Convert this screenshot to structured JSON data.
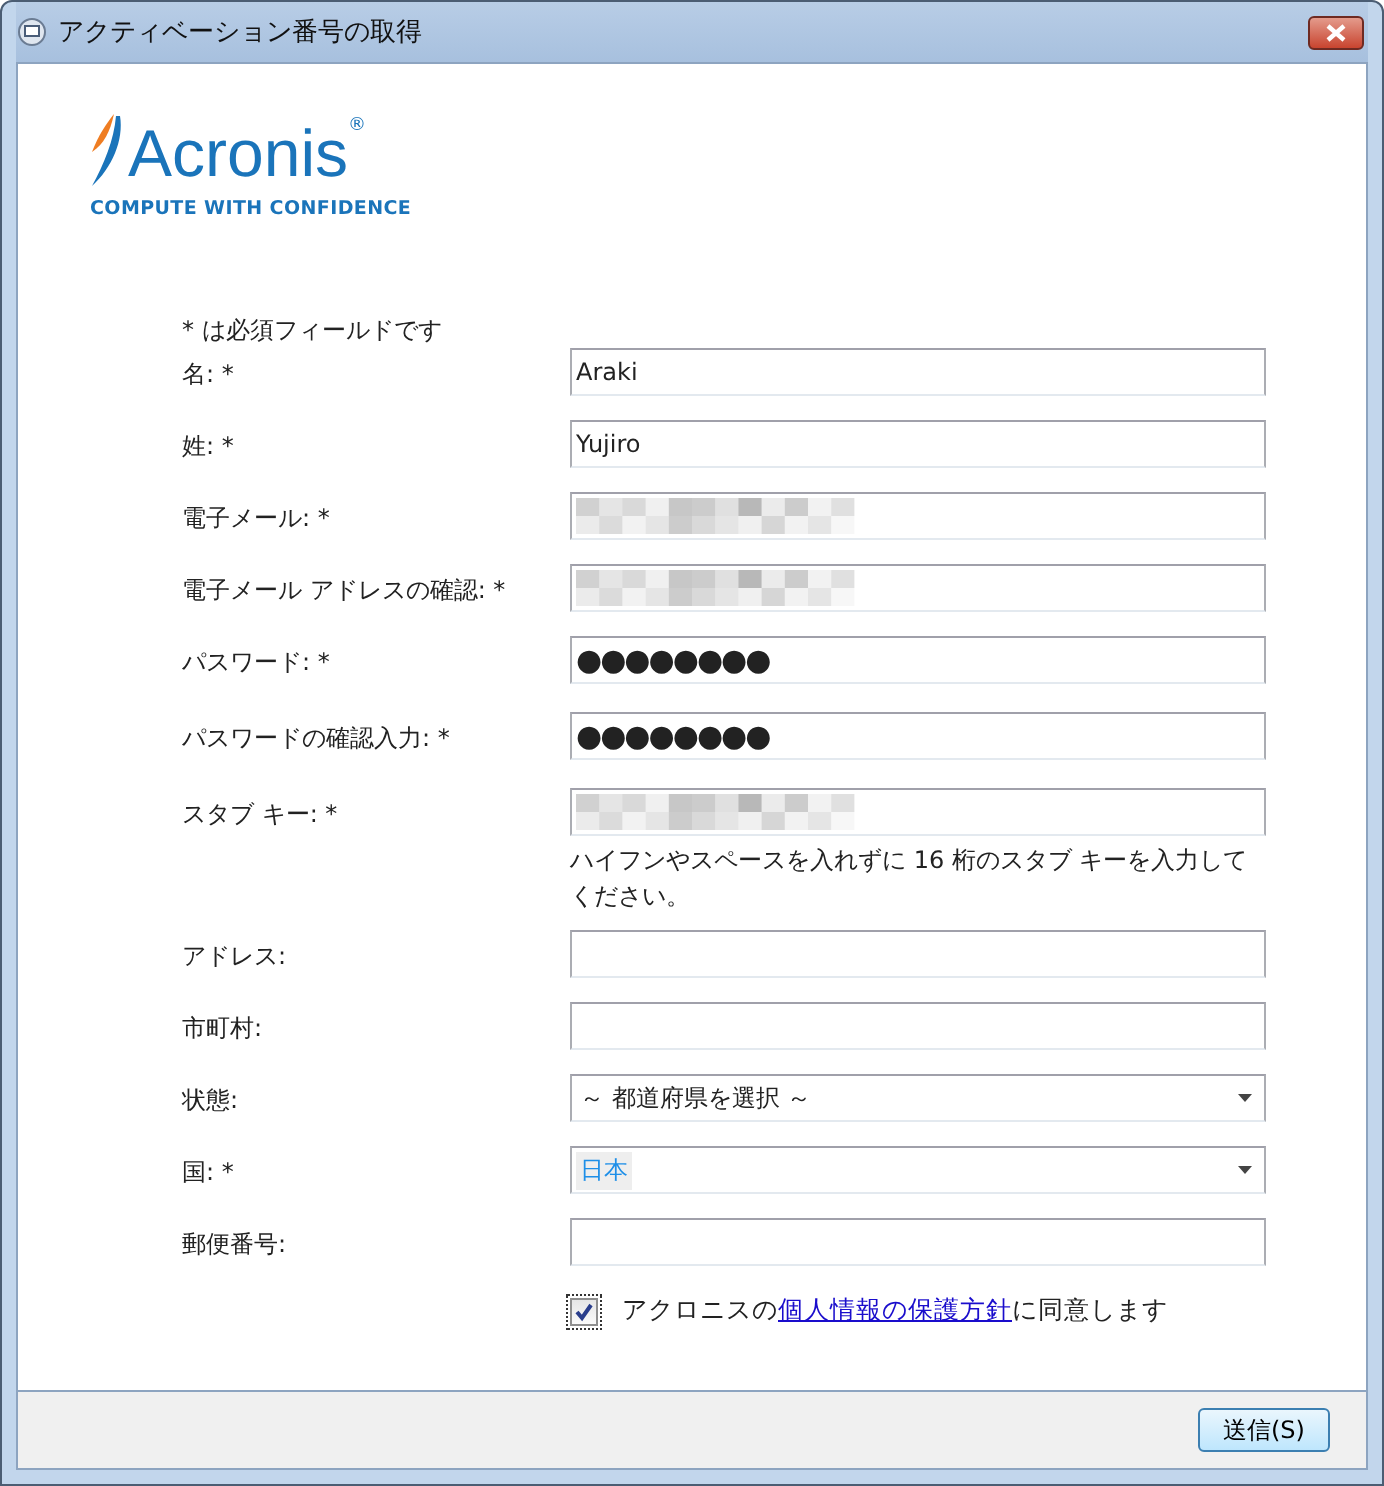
{
  "window": {
    "title": "アクティベーション番号の取得"
  },
  "logo": {
    "name": "Acronis",
    "mark": "®",
    "tagline": "COMPUTE WITH CONFIDENCE"
  },
  "required_note": "* は必須フィールドです",
  "fields": [
    {
      "label": "名: *",
      "kind": "text",
      "value": "Araki"
    },
    {
      "label": "姓: *",
      "kind": "text",
      "value": "Yujiro"
    },
    {
      "label": "電子メール: *",
      "kind": "masked"
    },
    {
      "label": "電子メール アドレスの確認: *",
      "kind": "masked"
    },
    {
      "label": "パスワード: *",
      "kind": "password",
      "value": "●●●●●●●●"
    },
    {
      "label": "パスワードの確認入力: *",
      "kind": "password",
      "value": "●●●●●●●●"
    },
    {
      "label": "スタブ キー: *",
      "kind": "masked",
      "hint": "ハイフンやスペースを入れずに 16 桁のスタブ キーを入力してください。"
    },
    {
      "label": "アドレス:",
      "kind": "text"
    },
    {
      "label": "市町村:",
      "kind": "text"
    },
    {
      "label": "状態:",
      "kind": "select",
      "value": "～ 都道府県を選択 ～",
      "focused": false
    },
    {
      "label": "国: *",
      "kind": "select",
      "value": "日本",
      "focused": true
    },
    {
      "label": "郵便番号:",
      "kind": "text"
    }
  ],
  "agreement": {
    "checked": true,
    "before": "アクロニスの",
    "link": "個人情報の保護方針",
    "after": "に同意します"
  },
  "submit_button": "送信(S)"
}
